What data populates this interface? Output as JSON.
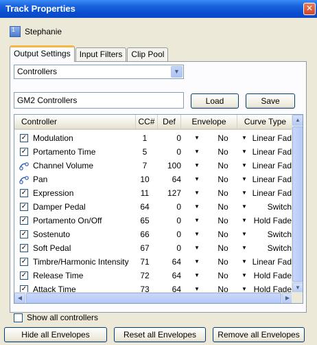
{
  "window": {
    "title": "Track Properties",
    "close_glyph": "✕"
  },
  "track": {
    "number": "1",
    "name": "Stephanie"
  },
  "tabs": [
    {
      "label": "Output Settings",
      "active": true
    },
    {
      "label": "Input Filters",
      "active": false
    },
    {
      "label": "Clip Pool",
      "active": false
    }
  ],
  "mode_select": {
    "value": "Controllers"
  },
  "preset": {
    "value": "GM2 Controllers",
    "load_label": "Load",
    "save_label": "Save"
  },
  "table": {
    "columns": [
      "Controller",
      "CC#",
      "Def",
      "Envelope",
      "Curve Type"
    ],
    "rows": [
      {
        "icon": "checkbox-checked",
        "controller": "Modulation",
        "cc": "1",
        "def": "0",
        "envelope": "No",
        "curve": "Linear Fad"
      },
      {
        "icon": "checkbox-checked",
        "controller": "Portamento Time",
        "cc": "5",
        "def": "0",
        "envelope": "No",
        "curve": "Linear Fad"
      },
      {
        "icon": "slider-icon",
        "controller": "Channel Volume",
        "cc": "7",
        "def": "100",
        "envelope": "No",
        "curve": "Linear Fad"
      },
      {
        "icon": "slider-icon",
        "controller": "Pan",
        "cc": "10",
        "def": "64",
        "envelope": "No",
        "curve": "Linear Fad"
      },
      {
        "icon": "checkbox-checked",
        "controller": "Expression",
        "cc": "11",
        "def": "127",
        "envelope": "No",
        "curve": "Linear Fad"
      },
      {
        "icon": "checkbox-checked",
        "controller": "Damper Pedal",
        "cc": "64",
        "def": "0",
        "envelope": "No",
        "curve": "Switch"
      },
      {
        "icon": "checkbox-checked",
        "controller": "Portamento On/Off",
        "cc": "65",
        "def": "0",
        "envelope": "No",
        "curve": "Hold Fade"
      },
      {
        "icon": "checkbox-checked",
        "controller": "Sostenuto",
        "cc": "66",
        "def": "0",
        "envelope": "No",
        "curve": "Switch"
      },
      {
        "icon": "checkbox-checked",
        "controller": "Soft Pedal",
        "cc": "67",
        "def": "0",
        "envelope": "No",
        "curve": "Switch"
      },
      {
        "icon": "checkbox-checked",
        "controller": "Timbre/Harmonic Intensity",
        "cc": "71",
        "def": "64",
        "envelope": "No",
        "curve": "Linear Fad"
      },
      {
        "icon": "checkbox-checked",
        "controller": "Release Time",
        "cc": "72",
        "def": "64",
        "envelope": "No",
        "curve": "Hold Fade"
      },
      {
        "icon": "checkbox-checked",
        "controller": "Attack Time",
        "cc": "73",
        "def": "64",
        "envelope": "No",
        "curve": "Hold Fade"
      }
    ]
  },
  "show_all": {
    "label": "Show all controllers",
    "checked": false
  },
  "footer": {
    "hide_label": "Hide all Envelopes",
    "reset_label": "Reset all Envelopes",
    "remove_label": "Remove all Envelopes"
  },
  "colors": {
    "titlebar": "#0a4fd0",
    "tab_accent": "#f7b643",
    "window_bg": "#ece9d8"
  }
}
